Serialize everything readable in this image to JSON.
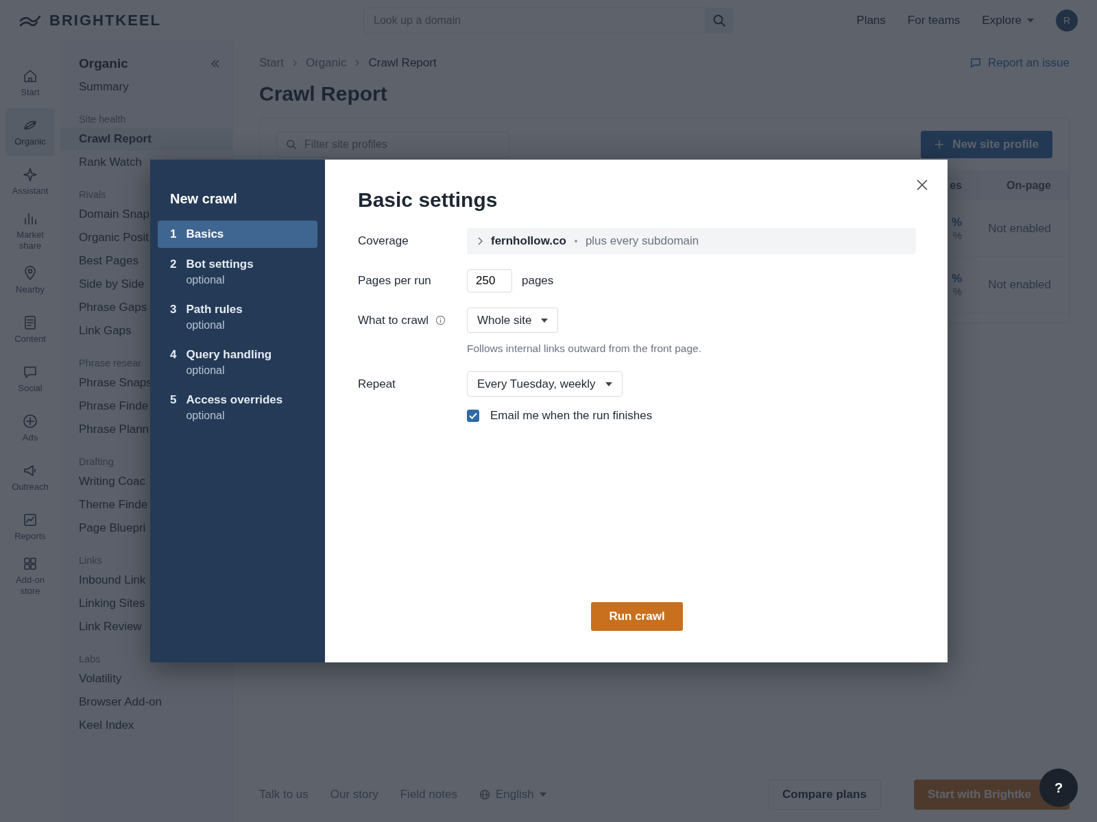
{
  "brand": {
    "name": "BRIGHTKEEL"
  },
  "search": {
    "placeholder": "Look up a domain"
  },
  "top_nav": [
    {
      "label": "Plans",
      "dropdown": false
    },
    {
      "label": "For teams",
      "dropdown": false
    },
    {
      "label": "Explore",
      "dropdown": true
    }
  ],
  "user": {
    "initial": "R"
  },
  "rail": [
    {
      "label": "Start",
      "selected": false
    },
    {
      "label": "Organic",
      "selected": true
    },
    {
      "label": "Assistant",
      "selected": false
    },
    {
      "label": "Market share",
      "selected": false
    },
    {
      "label": "Nearby",
      "selected": false
    },
    {
      "label": "Content",
      "selected": false
    },
    {
      "label": "Social",
      "selected": false
    },
    {
      "label": "Ads",
      "selected": false
    },
    {
      "label": "Outreach",
      "selected": false
    },
    {
      "label": "Reports",
      "selected": false
    },
    {
      "label": "Add-on store",
      "selected": false
    }
  ],
  "sidebar": {
    "title": "Organic",
    "items": [
      {
        "kind": "link",
        "label": "Summary",
        "selected": false
      },
      {
        "kind": "heading",
        "label": "Site health"
      },
      {
        "kind": "link",
        "label": "Crawl Report",
        "selected": true
      },
      {
        "kind": "link",
        "label": "Rank Watch",
        "selected": false
      },
      {
        "kind": "heading",
        "label": "Rivals"
      },
      {
        "kind": "link",
        "label": "Domain Snap",
        "selected": false
      },
      {
        "kind": "link",
        "label": "Organic Posit",
        "selected": false
      },
      {
        "kind": "link",
        "label": "Best Pages",
        "selected": false
      },
      {
        "kind": "link",
        "label": "Side by Side",
        "selected": false
      },
      {
        "kind": "link",
        "label": "Phrase Gaps",
        "selected": false
      },
      {
        "kind": "link",
        "label": "Link Gaps",
        "selected": false
      },
      {
        "kind": "heading",
        "label": "Phrase resear"
      },
      {
        "kind": "link",
        "label": "Phrase Snaps",
        "selected": false
      },
      {
        "kind": "link",
        "label": "Phrase Finde",
        "selected": false
      },
      {
        "kind": "link",
        "label": "Phrase Plann",
        "selected": false
      },
      {
        "kind": "heading",
        "label": "Drafting"
      },
      {
        "kind": "link",
        "label": "Writing Coac",
        "selected": false
      },
      {
        "kind": "link",
        "label": "Theme Finde",
        "selected": false
      },
      {
        "kind": "link",
        "label": "Page Bluepri",
        "selected": false
      },
      {
        "kind": "heading",
        "label": "Links"
      },
      {
        "kind": "link",
        "label": "Inbound Link",
        "selected": false
      },
      {
        "kind": "link",
        "label": "Linking Sites",
        "selected": false
      },
      {
        "kind": "link",
        "label": "Link Review",
        "selected": false
      },
      {
        "kind": "heading",
        "label": "Labs"
      },
      {
        "kind": "link",
        "label": "Volatility",
        "selected": false
      },
      {
        "kind": "link",
        "label": "Browser Add-on",
        "selected": false
      },
      {
        "kind": "link",
        "label": "Keel Index",
        "selected": false
      }
    ]
  },
  "breadcrumbs": [
    "Start",
    "Organic",
    "Crawl Report"
  ],
  "report_link": "Report an issue",
  "page_title": "Crawl Report",
  "filter": {
    "placeholder": "Filter site profiles"
  },
  "new_button": "New site profile",
  "table": {
    "columns": [
      "es",
      "On-page"
    ],
    "rows": [
      {
        "column_1": [
          "%",
          "%"
        ],
        "on_page": "Not enabled"
      },
      {
        "column_1": [
          "%",
          "%"
        ],
        "on_page": "Not enabled"
      }
    ]
  },
  "footer": {
    "links": [
      "Talk to us",
      "Our story",
      "Field notes"
    ],
    "language": "English",
    "compare": "Compare plans",
    "start": "Start with Brightke"
  },
  "help": "?",
  "modal": {
    "title": "New crawl",
    "steps": [
      {
        "number": "1",
        "label": "Basics",
        "selected": true
      },
      {
        "number": "2",
        "label": "Bot settings",
        "note": "optional",
        "selected": false
      },
      {
        "number": "3",
        "label": "Path rules",
        "note": "optional",
        "selected": false
      },
      {
        "number": "4",
        "label": "Query handling",
        "note": "optional",
        "selected": false
      },
      {
        "number": "5",
        "label": "Access overrides",
        "note": "optional",
        "selected": false
      }
    ],
    "heading": "Basic settings",
    "coverage": {
      "label": "Coverage",
      "domain": "fernhollow.co",
      "scope": "plus every subdomain"
    },
    "pages": {
      "label": "Pages per run",
      "value": "250",
      "unit": "pages"
    },
    "what": {
      "label": "What to crawl",
      "value": "Whole site",
      "hint": "Follows internal links outward from the front page."
    },
    "repeat": {
      "label": "Repeat",
      "value": "Every Tuesday, weekly"
    },
    "email": {
      "label": "Email me when the run finishes",
      "checked": true
    },
    "submit": "Run crawl"
  }
}
